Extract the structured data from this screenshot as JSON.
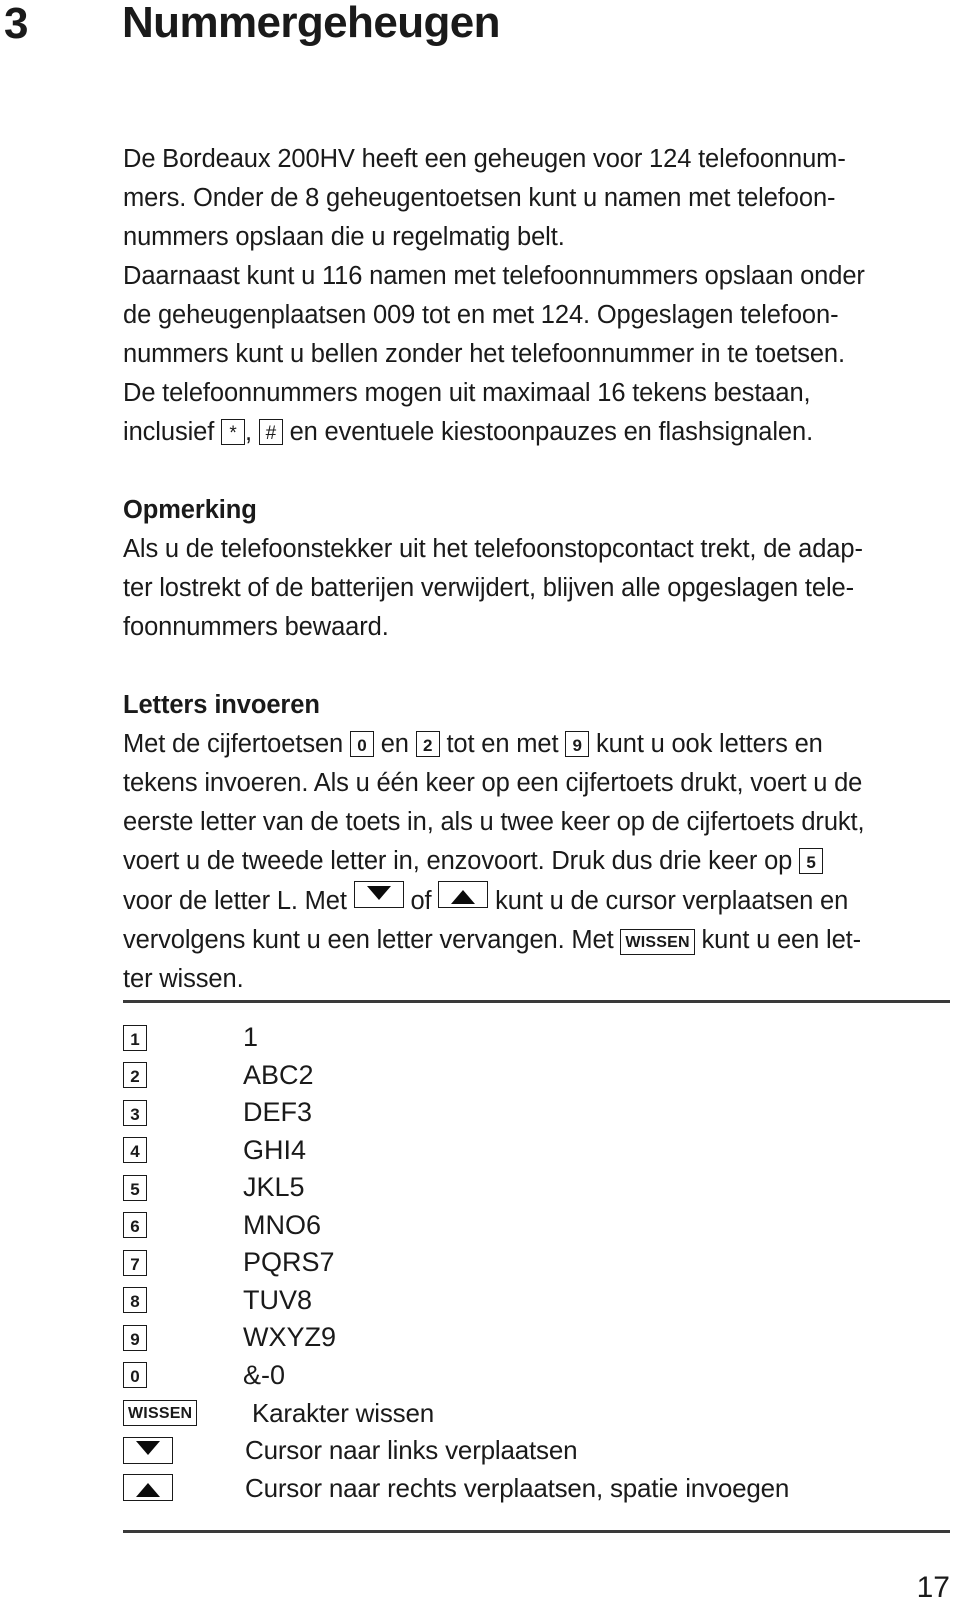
{
  "header": {
    "chapter_number": "3",
    "chapter_title": "Nummergeheugen"
  },
  "body": {
    "paragraph_1_part_1": "De Bordeaux 200HV heeft een geheugen voor 124 telefoonnum-",
    "paragraph_1_part_2": "mers. Onder de 8 geheugentoetsen kunt u namen met telefoon-",
    "paragraph_1_part_3": "nummers opslaan die u regelmatig belt.",
    "paragraph_1_part_4": "Daarnaast kunt u 116 namen met telefoonnummers opslaan onder",
    "paragraph_1_part_5": "de geheugenplaatsen 009 tot en met 124. Opgeslagen telefoon-",
    "paragraph_1_part_6": "nummers kunt u bellen zonder het telefoonnummer in te toetsen.",
    "paragraph_1_part_7": "De telefoonnummers mogen uit maximaal 16 tekens bestaan,",
    "paragraph_1_part_8a": "inclusief ",
    "paragraph_1_key_star": "*",
    "paragraph_1_part_8b": ", ",
    "paragraph_1_key_hash": "#",
    "paragraph_1_part_8c": " en eventuele kiestoonpauzes en flashsignalen."
  },
  "note": {
    "heading": "Opmerking",
    "line_1": "Als u de telefoonstekker uit het telefoonstopcontact trekt, de adap-",
    "line_2": "ter lostrekt of de batterijen verwijdert, blijven alle opgeslagen tele-",
    "line_3": "foonnummers bewaard."
  },
  "letters": {
    "heading": "Letters invoeren",
    "line_1a": "Met de cijfertoetsen ",
    "key_0": "0",
    "line_1b": " en ",
    "key_2": "2",
    "line_1c": " tot en met ",
    "key_9": "9",
    "line_1d": " kunt u ook letters en",
    "line_2": "tekens invoeren. Als u één keer op een cijfertoets drukt, voert u de",
    "line_3": "eerste letter van de toets in, als u twee keer op de cijfertoets drukt,",
    "line_4a": "voert u de tweede letter in, enzovoort. Druk dus drie keer op ",
    "key_5": "5",
    "line_5a": "voor de letter L. Met ",
    "key_down": "arrow-down",
    "line_5b": " of ",
    "key_up": "arrow-up",
    "line_5c": " kunt u de cursor verplaatsen en",
    "line_6a": "vervolgens kunt u een letter vervangen. Met ",
    "key_wissen": "WISSEN",
    "line_6b": " kunt u een let-",
    "line_7": "ter wissen."
  },
  "key_table": {
    "rows": [
      {
        "key_type": "digit",
        "key_label": "1",
        "label": "1",
        "label_style": "normal"
      },
      {
        "key_type": "digit",
        "key_label": "2",
        "label": "ABC2",
        "label_style": "normal"
      },
      {
        "key_type": "digit",
        "key_label": "3",
        "label": "DEF3",
        "label_style": "normal"
      },
      {
        "key_type": "digit",
        "key_label": "4",
        "label": "GHI4",
        "label_style": "normal"
      },
      {
        "key_type": "digit",
        "key_label": "5",
        "label": "JKL5",
        "label_style": "normal"
      },
      {
        "key_type": "digit",
        "key_label": "6",
        "label": "MNO6",
        "label_style": "normal"
      },
      {
        "key_type": "digit",
        "key_label": "7",
        "label": "PQRS7",
        "label_style": "normal"
      },
      {
        "key_type": "digit",
        "key_label": "8",
        "label": "TUV8",
        "label_style": "normal"
      },
      {
        "key_type": "digit",
        "key_label": "9",
        "label": "WXYZ9",
        "label_style": "normal"
      },
      {
        "key_type": "digit",
        "key_label": "0",
        "label": "&-0",
        "label_style": "normal"
      },
      {
        "key_type": "wide",
        "key_label": "WISSEN",
        "label": "Karakter wissen",
        "label_style": "cond"
      },
      {
        "key_type": "arrow-down",
        "key_label": "arrow-down",
        "label": "Cursor naar links verplaatsen",
        "label_style": "cond"
      },
      {
        "key_type": "arrow-up",
        "key_label": "arrow-up",
        "label": "Cursor naar rechts verplaatsen, spatie invoegen",
        "label_style": "cond"
      }
    ]
  },
  "footer": {
    "page_number": "17"
  },
  "colors": {
    "text": "#1a1a1a",
    "rule": "#3a3a3a",
    "background": "#ffffff"
  }
}
